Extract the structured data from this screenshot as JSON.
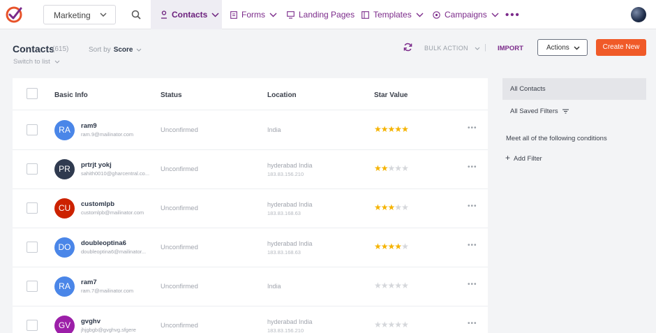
{
  "nav": {
    "app_select": "Marketing",
    "tabs": [
      {
        "label": "Contacts",
        "icon": "person-icon",
        "active": true
      },
      {
        "label": "Forms",
        "icon": "form-icon"
      },
      {
        "label": "Landing Pages",
        "icon": "monitor-icon"
      },
      {
        "label": "Templates",
        "icon": "template-icon"
      },
      {
        "label": "Campaigns",
        "icon": "campaign-icon"
      }
    ],
    "more": "•••"
  },
  "header": {
    "title": "Contacts",
    "count": "(615)",
    "sort_by_label": "Sort by",
    "sort_by_value": "Score",
    "switch_view": "Switch to list",
    "bulk_action": "BULK ACTION",
    "separator": "|",
    "import": "IMPORT",
    "actions": "Actions",
    "create": "Create New"
  },
  "table": {
    "columns": [
      "Basic Info",
      "Status",
      "Location",
      "Star Value"
    ],
    "rows": [
      {
        "initials": "RA",
        "color": "#4a86e8",
        "name": "ram9",
        "email": "ram.9@mailinator.com",
        "status": "Unconfirmed",
        "location": "India",
        "ip": "",
        "stars": 5
      },
      {
        "initials": "PR",
        "color": "#2f3a4f",
        "name": "prtrjt yokj",
        "email": "sahith0010@gharcentral.co...",
        "status": "Unconfirmed",
        "location": "hyderabad India",
        "ip": "183.83.156.210",
        "stars": 2
      },
      {
        "initials": "CU",
        "color": "#cc2200",
        "name": "customlpb",
        "email": "customlpb@mailinator.com",
        "status": "Unconfirmed",
        "location": "hyderabad India",
        "ip": "183.83.168.63",
        "stars": 3
      },
      {
        "initials": "DO",
        "color": "#4a86e8",
        "name": "doubleoptina6",
        "email": "doubleoptina6@mailinator...",
        "status": "Unconfirmed",
        "location": "hyderabad India",
        "ip": "183.83.168.63",
        "stars": 4
      },
      {
        "initials": "RA",
        "color": "#4a86e8",
        "name": "ram7",
        "email": "ram.7@mailinator.com",
        "status": "Unconfirmed",
        "location": "India",
        "ip": "",
        "stars": 0
      },
      {
        "initials": "GV",
        "color": "#9c1fa8",
        "name": "gvghv",
        "email": "jhjgbgb@gvghvg.sfgere",
        "status": "Unconfirmed",
        "location": "hyderabad India",
        "ip": "183.83.156.210",
        "stars": 0
      }
    ],
    "row_more": "•••"
  },
  "filters": {
    "all_contacts": "All Contacts",
    "saved_filters": "All Saved Filters",
    "conditions": "Meet all of the following conditions",
    "add_filter_plus": "+",
    "add_filter": "Add Filter"
  },
  "colors": {
    "brand": "#7b2a8a",
    "create_button": "#f05a28",
    "star_on": "#f5b301",
    "star_off": "#d5d7db"
  }
}
